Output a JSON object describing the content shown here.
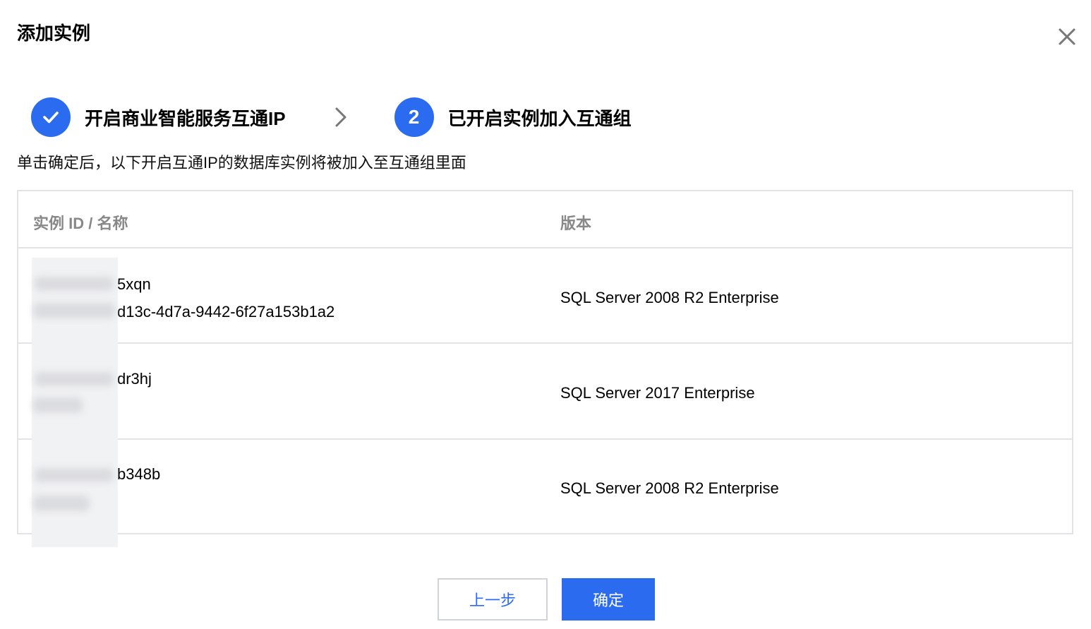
{
  "dialog": {
    "title": "添加实例",
    "close_icon": "close-icon"
  },
  "steps": [
    {
      "status": "done",
      "icon": "check-icon",
      "number": "",
      "label": "开启商业智能服务互通IP"
    },
    {
      "status": "active",
      "icon": "",
      "number": "2",
      "label": "已开启实例加入互通组"
    }
  ],
  "description": "单击确定后，以下开启互通IP的数据库实例将被加入至互通组里面",
  "table": {
    "headers": [
      "实例 ID / 名称",
      "版本"
    ],
    "rows": [
      {
        "id_suffix": "5xqn",
        "name_suffix": "d13c-4d7a-9442-6f27a153b1a2",
        "version": "SQL Server 2008 R2 Enterprise"
      },
      {
        "id_suffix": "dr3hj",
        "name_suffix": "",
        "version": "SQL Server 2017 Enterprise"
      },
      {
        "id_suffix": "b348b",
        "name_suffix": "",
        "version": "SQL Server 2008 R2 Enterprise"
      }
    ]
  },
  "buttons": {
    "prev_label": "上一步",
    "ok_label": "确定"
  },
  "colors": {
    "accent": "#2b6bf0",
    "border": "#e2e3e7",
    "header_text": "#888888"
  }
}
